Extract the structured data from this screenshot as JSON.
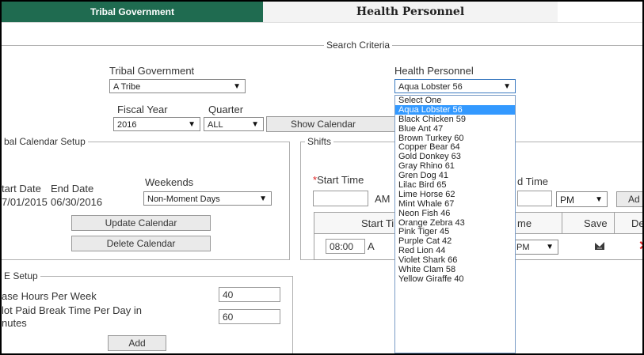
{
  "tabs": {
    "tribal": "Tribal Government",
    "health": "Health Personnel"
  },
  "search": {
    "legend": "Search Criteria",
    "tribal_label": "Tribal Government",
    "tribal_value": "A Tribe",
    "health_label": "Health Personnel",
    "health_value": "Aqua Lobster 56",
    "fiscal_label": "Fiscal Year",
    "fiscal_value": "2016",
    "quarter_label": "Quarter",
    "quarter_value": "ALL",
    "show_calendar": "Show Calendar"
  },
  "calendar_setup": {
    "legend": "bal Calendar Setup",
    "start_label": "tart Date",
    "end_label": "End Date",
    "weekends_label": "Weekends",
    "start_value": "7/01/2015",
    "end_value": "06/30/2016",
    "weekends_value": "Non-Moment Days",
    "update_button": "Update Calendar",
    "delete_button": "Delete Calendar"
  },
  "shifts": {
    "legend": "Shifts",
    "required_star": "*",
    "start_time_label": "Start Time",
    "end_time_label": "d Time",
    "start_ampm": "AM",
    "end_ampm": "PM",
    "add_button": "Ad",
    "col_start": "Start Tin",
    "col_end": "me",
    "col_save": "Save",
    "col_delete": "De",
    "row_start": "08:00",
    "row_start_ampm": "A",
    "row_end_ampm": "PM"
  },
  "fte_setup": {
    "legend": "E Setup",
    "base_hours_label": "ase Hours Per Week",
    "base_hours_value": "40",
    "break_label_line1": "lot Paid Break Time Per Day in",
    "break_label_line2": "nutes",
    "break_value": "60",
    "add_button": "Add"
  },
  "dropdown_options": [
    "Select One",
    "Aqua Lobster 56",
    "Black Chicken 59",
    "Blue Ant 47",
    "Brown Turkey 60",
    "Copper Bear 64",
    "Gold Donkey 63",
    "Gray Rhino 61",
    "Gren Dog 41",
    "Lilac Bird 65",
    "Lime Horse 62",
    "Mint Whale 67",
    "Neon Fish 46",
    "Orange Zebra 43",
    "Pink Tiger 45",
    "Purple Cat 42",
    "Red Lion 44",
    "Violet Shark 66",
    "White Clam 58",
    "Yellow Giraffe 40"
  ],
  "dropdown_selected_index": 1,
  "colors": {
    "tab_active": "#1f6b50",
    "selection": "#3399ff"
  }
}
